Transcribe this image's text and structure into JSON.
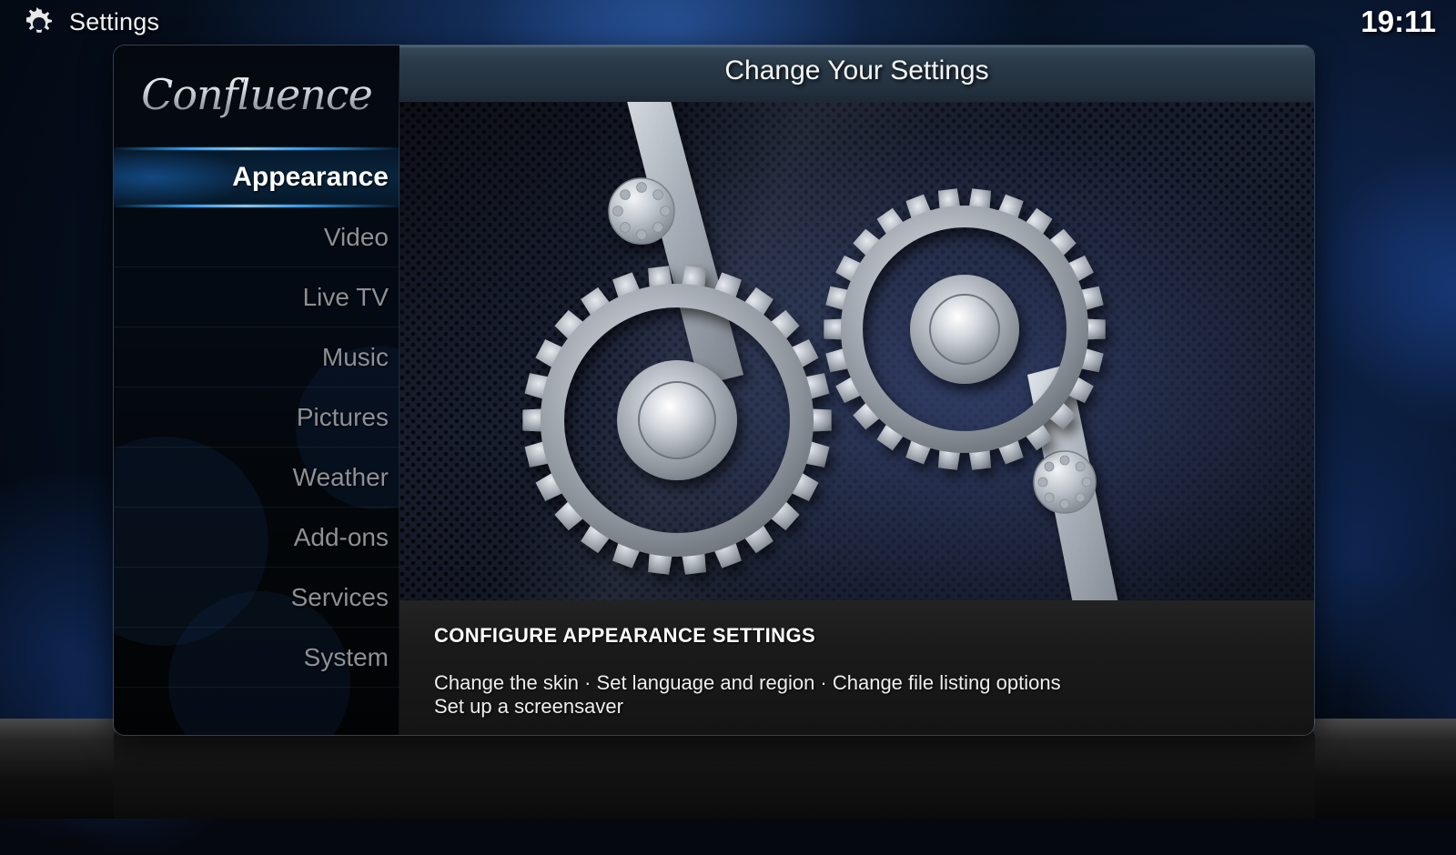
{
  "topbar": {
    "gear_icon": "gear-icon",
    "title": "Settings",
    "clock": "19:11"
  },
  "sidebar": {
    "logo": "Confluence",
    "items": [
      {
        "label": "Appearance",
        "selected": true
      },
      {
        "label": "Video",
        "selected": false
      },
      {
        "label": "Live TV",
        "selected": false
      },
      {
        "label": "Music",
        "selected": false
      },
      {
        "label": "Pictures",
        "selected": false
      },
      {
        "label": "Weather",
        "selected": false
      },
      {
        "label": "Add-ons",
        "selected": false
      },
      {
        "label": "Services",
        "selected": false
      },
      {
        "label": "System",
        "selected": false
      }
    ]
  },
  "pane": {
    "title": "Change Your Settings",
    "thumbnail_icon": "gears-illustration",
    "description": {
      "heading": "CONFIGURE APPEARANCE SETTINGS",
      "lines": [
        "Change the skin · Set language and region · Change file listing options",
        "Set up a screensaver"
      ]
    }
  },
  "colors": {
    "accent_blue": "#3fa9ff",
    "selected_text": "#ffffff",
    "item_text": "#8d9095",
    "header_slate": "#2a3a48",
    "desc_background": "#1b1b1b",
    "desktop_navy": "#0b1c38",
    "mesh_navy": "#1b2030",
    "gear_silver": "#b9bec6"
  }
}
